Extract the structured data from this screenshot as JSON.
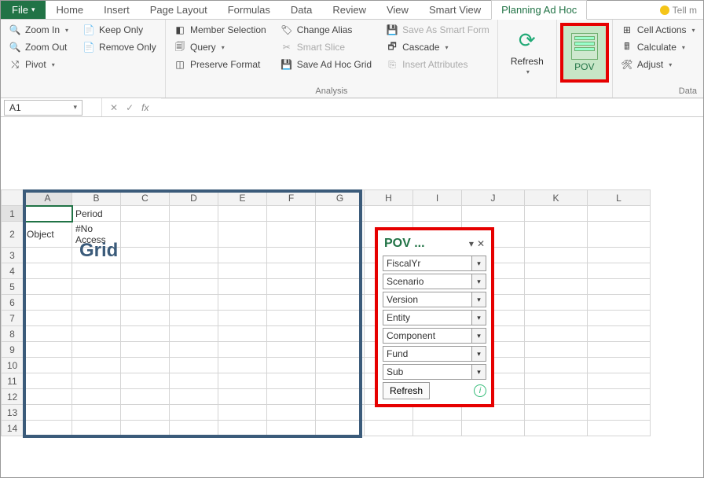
{
  "tabs": {
    "file": "File",
    "list": [
      "Home",
      "Insert",
      "Page Layout",
      "Formulas",
      "Data",
      "Review",
      "View",
      "Smart View",
      "Planning Ad Hoc"
    ],
    "active": "Planning Ad Hoc",
    "tellme": "Tell m"
  },
  "ribbon": {
    "group1": {
      "zoom_in": "Zoom In",
      "zoom_out": "Zoom Out",
      "pivot": "Pivot",
      "keep_only": "Keep Only",
      "remove_only": "Remove Only"
    },
    "analysis": {
      "label": "Analysis",
      "member_selection": "Member Selection",
      "query": "Query",
      "preserve_format": "Preserve Format",
      "change_alias": "Change Alias",
      "smart_slice": "Smart Slice",
      "save_adhoc": "Save Ad Hoc Grid",
      "save_smart_form": "Save As Smart Form",
      "cascade": "Cascade",
      "insert_attributes": "Insert Attributes"
    },
    "refresh": "Refresh",
    "pov": "POV",
    "data": {
      "label": "Data",
      "cell_actions": "Cell Actions",
      "calculate": "Calculate",
      "adjust": "Adjust"
    }
  },
  "namebox": "A1",
  "sheet": {
    "columns": [
      "A",
      "B",
      "C",
      "D",
      "E",
      "F",
      "G",
      "H",
      "I",
      "J",
      "K",
      "L"
    ],
    "rows": 14,
    "cells": {
      "B1": "Period",
      "A2": "Object",
      "B2": "#No Access"
    },
    "selected": "A1"
  },
  "gridLabel": "Grid",
  "pov": {
    "title": "POV ...",
    "items": [
      "FiscalYr",
      "Scenario",
      "Version",
      "Entity",
      "Component",
      "Fund",
      "Sub"
    ],
    "refresh": "Refresh"
  }
}
